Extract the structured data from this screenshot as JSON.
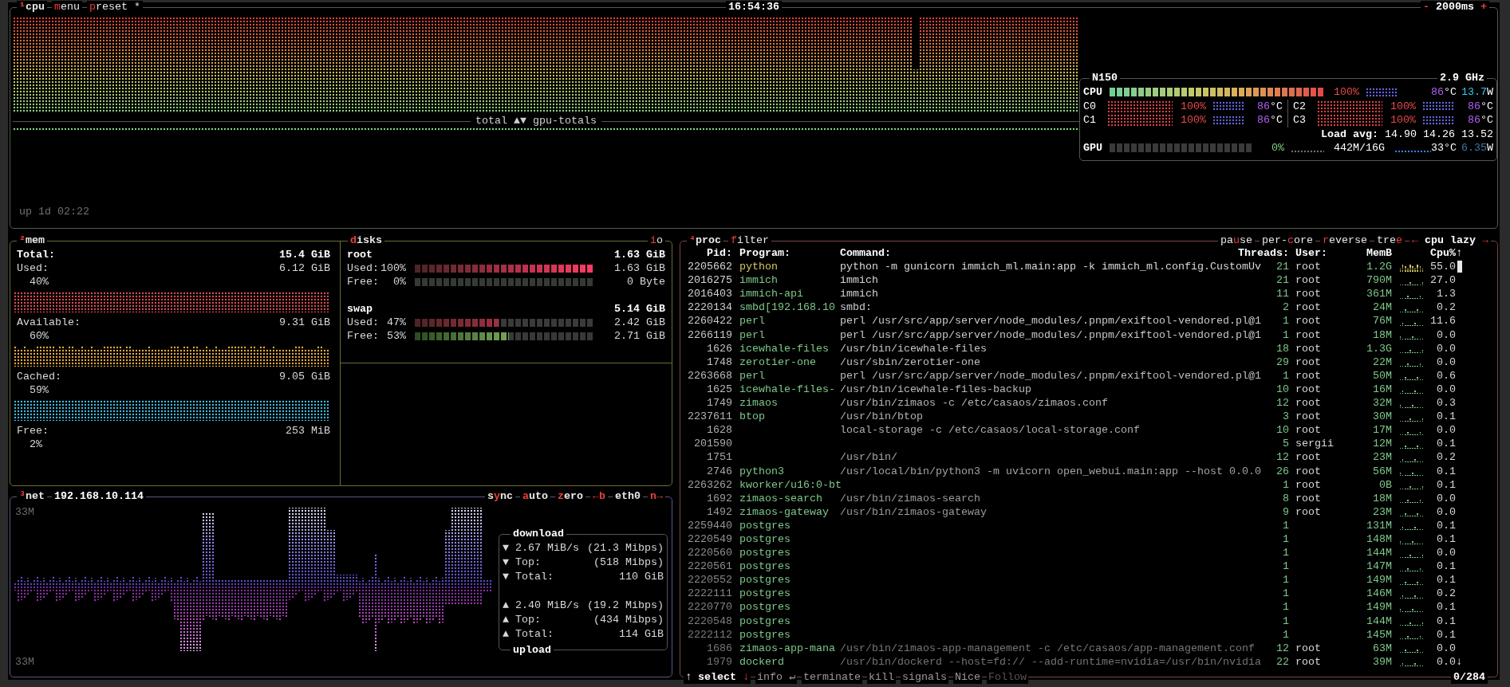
{
  "cpu_box": {
    "title": [
      {
        "key": "¹",
        "after": "cpu"
      },
      {
        "key": "m",
        "after": "enu"
      },
      {
        "key": "p",
        "after": "reset *"
      }
    ],
    "clock": "16:54:36",
    "interval": {
      "minus": "-",
      "value": "2000ms",
      "plus": "+"
    },
    "graph_label": "total ▲▼ gpu-totals",
    "uptime": "up 1d 02:22",
    "info": {
      "model": "N150",
      "frequency": "2.9 GHz",
      "total": {
        "label": "CPU",
        "percent": "100%",
        "temp": "86",
        "temp_unit": "°C",
        "power": "13.7",
        "power_unit": "W"
      },
      "cores": [
        {
          "label": "C0",
          "percent": "100%",
          "temp": "86",
          "temp_unit": "°C"
        },
        {
          "label": "C2",
          "percent": "100%",
          "temp": "86",
          "temp_unit": "°C"
        },
        {
          "label": "C1",
          "percent": "100%",
          "temp": "86",
          "temp_unit": "°C"
        },
        {
          "label": "C3",
          "percent": "100%",
          "temp": "86",
          "temp_unit": "°C"
        }
      ],
      "load_avg": {
        "label": "Load avg:",
        "values": [
          "14.90",
          "14.26",
          "13.52"
        ]
      },
      "gpu": {
        "label": "GPU",
        "percent": "0%",
        "memory": "442M/16G",
        "temp": "33°C",
        "power": "6.35",
        "power_unit": "W"
      }
    }
  },
  "mem": {
    "title": {
      "key": "²",
      "after": "mem"
    },
    "total": {
      "label": "Total:",
      "value": "15.4 GiB"
    },
    "items": [
      {
        "label": "Used:",
        "value": "6.12 GiB",
        "percent": "40%",
        "color": "#e8505a"
      },
      {
        "label": "Available:",
        "value": "9.31 GiB",
        "percent": "60%",
        "color": "#f2b53a"
      },
      {
        "label": "Cached:",
        "value": "9.05 GiB",
        "percent": "59%",
        "color": "#3fc8f2"
      },
      {
        "label": "Free:",
        "value": "253 MiB",
        "percent": "2%"
      }
    ]
  },
  "disks": {
    "title": {
      "key": "d",
      "after": "isks"
    },
    "io": {
      "key": "i",
      "after": "o"
    },
    "devices": [
      {
        "name": "root",
        "total": "1.63 GiB",
        "rows": [
          {
            "kind": "used",
            "label": "Used:",
            "percent": "100%",
            "value": "1.63 GiB"
          },
          {
            "kind": "free",
            "label": "Free:",
            "percent": "0%",
            "value": "0 Byte"
          }
        ]
      },
      {
        "name": "swap",
        "total": "5.14 GiB",
        "rows": [
          {
            "kind": "used",
            "label": "Used:",
            "percent": "47%",
            "level": 0.47,
            "value": "2.42 GiB"
          },
          {
            "kind": "free",
            "label": "Free:",
            "percent": "53%",
            "level": 0.53,
            "value": "2.71 GiB"
          }
        ]
      }
    ]
  },
  "net": {
    "title": {
      "key": "³",
      "after": "net"
    },
    "address": "192.168.10.114",
    "controls": [
      {
        "before": "s",
        "key": "y",
        "after": "nc"
      },
      {
        "key": "a",
        "after": "uto"
      },
      {
        "key": "z",
        "after": "ero"
      },
      {
        "key": "←b"
      },
      {
        "before": "eth0"
      },
      {
        "key": "n→"
      }
    ],
    "scale_top": "33M",
    "scale_bottom": "33M",
    "download": {
      "title": "download",
      "rows": [
        {
          "arrow": "▼",
          "label": "2.67 MiB/s",
          "value": "(21.3 Mibps)"
        },
        {
          "arrow": "▼",
          "label": "Top:",
          "value": "(518 Mibps)"
        },
        {
          "arrow": "▼",
          "label": "Total:",
          "value": "110 GiB"
        }
      ]
    },
    "upload": {
      "title": "upload",
      "rows": [
        {
          "arrow": "▲",
          "label": "2.40 MiB/s",
          "value": "(19.2 Mibps)"
        },
        {
          "arrow": "▲",
          "label": "Top:",
          "value": "(434 Mibps)"
        },
        {
          "arrow": "▲",
          "label": "Total:",
          "value": "114 GiB"
        }
      ]
    }
  },
  "proc": {
    "title": [
      {
        "key": "⁴",
        "after": "proc"
      },
      {
        "key": "f",
        "after": "ilter"
      }
    ],
    "options": [
      {
        "before": "pa",
        "key": "u",
        "after": "se"
      },
      {
        "before": "per-",
        "key": "c",
        "after": "ore"
      },
      {
        "key": "r",
        "after": "everse"
      },
      {
        "before": "tre",
        "key": "e"
      }
    ],
    "sort": {
      "left": "←",
      "label": "cpu lazy",
      "right": "→"
    },
    "columns": [
      "Pid:",
      "Program:",
      "Command:",
      "Threads:",
      "User:",
      "MemB",
      "Cpu%",
      "↑"
    ],
    "rows": [
      {
        "pid": "2205662",
        "program": "python",
        "command": "python -m gunicorn immich_ml.main:app -k immich_ml.config.CustomUv",
        "threads": "21",
        "user": "root",
        "mem": "1.2G",
        "cpu": "55.0",
        "color": "#d8c860"
      },
      {
        "pid": "2016275",
        "program": "immich",
        "command": "immich",
        "threads": "21",
        "user": "root",
        "mem": "790M",
        "cpu": "27.0",
        "color": "#7ec88a"
      },
      {
        "pid": "2016403",
        "program": "immich-api",
        "command": "immich",
        "threads": "11",
        "user": "root",
        "mem": "361M",
        "cpu": "1.3",
        "color": "#7ec88a"
      },
      {
        "pid": "2220134",
        "program": "smbd[192.168.10",
        "command": "smbd:",
        "threads": "2",
        "user": "root",
        "mem": "24M",
        "cpu": "0.2",
        "color": "#7ec88a"
      },
      {
        "pid": "2260422",
        "program": "perl",
        "command": "perl /usr/src/app/server/node_modules/.pnpm/exiftool-vendored.pl@1",
        "threads": "1",
        "user": "root",
        "mem": "76M",
        "cpu": "11.6",
        "color": "#7ec88a"
      },
      {
        "pid": "2266119",
        "program": "perl",
        "command": "perl /usr/src/app/server/node_modules/.pnpm/exiftool-vendored.pl@1",
        "threads": "1",
        "user": "root",
        "mem": "18M",
        "cpu": "0.0",
        "color": "#7ec88a"
      },
      {
        "pid": "1626",
        "program": "icewhale-files",
        "command": "/usr/bin/icewhale-files",
        "threads": "18",
        "user": "root",
        "mem": "1.3G",
        "cpu": "0.0",
        "color": "#7ec88a"
      },
      {
        "pid": "1748",
        "program": "zerotier-one",
        "command": "/usr/sbin/zerotier-one",
        "threads": "29",
        "user": "root",
        "mem": "22M",
        "cpu": "0.0",
        "color": "#7ec88a"
      },
      {
        "pid": "2263668",
        "program": "perl",
        "command": "perl /usr/src/app/server/node_modules/.pnpm/exiftool-vendored.pl@1",
        "threads": "1",
        "user": "root",
        "mem": "50M",
        "cpu": "0.6",
        "color": "#7ec88a"
      },
      {
        "pid": "1625",
        "program": "icewhale-files-",
        "command": "/usr/bin/icewhale-files-backup",
        "threads": "10",
        "user": "root",
        "mem": "16M",
        "cpu": "0.0",
        "color": "#7ec88a"
      },
      {
        "pid": "1749",
        "program": "zimaos",
        "command": "/usr/bin/zimaos -c /etc/casaos/zimaos.conf",
        "threads": "12",
        "user": "root",
        "mem": "32M",
        "cpu": "0.3",
        "color": "#7ec88a"
      },
      {
        "pid": "2237611",
        "program": "btop",
        "command": "/usr/bin/btop",
        "threads": "3",
        "user": "root",
        "mem": "30M",
        "cpu": "0.1",
        "color": "#7ec88a"
      },
      {
        "pid": "1628",
        "command": "local-storage -c /etc/casaos/local-storage.conf",
        "threads": "10",
        "user": "root",
        "mem": "17M",
        "cpu": "0.0",
        "color": "#7ec88a"
      },
      {
        "pid": "201590",
        "threads": "5",
        "user": "sergii",
        "mem": "12M",
        "cpu": "0.1",
        "color": "#7ec88a"
      },
      {
        "pid": "1751",
        "command": "/usr/bin/",
        "threads": "12",
        "user": "root",
        "mem": "23M",
        "cpu": "0.2",
        "color": "#7ec88a"
      },
      {
        "pid": "2746",
        "program": "python3",
        "command": "/usr/local/bin/python3 -m uvicorn open_webui.main:app --host 0.0.0",
        "threads": "26",
        "user": "root",
        "mem": "56M",
        "cpu": "0.1",
        "color": "#7ec88a"
      },
      {
        "pid": "2263262",
        "program": "kworker/u16:0-bt",
        "threads": "1",
        "user": "root",
        "mem": "0B",
        "cpu": "0.1",
        "color": "#7ec88a"
      },
      {
        "pid": "1692",
        "program": "zimaos-search",
        "command": "/usr/bin/zimaos-search",
        "threads": "8",
        "user": "root",
        "mem": "18M",
        "cpu": "0.0",
        "color": "#7ec88a"
      },
      {
        "pid": "1492",
        "program": "zimaos-gateway",
        "command": "/usr/bin/zimaos-gateway",
        "threads": "9",
        "user": "root",
        "mem": "23M",
        "cpu": "0.0",
        "color": "#7ec88a"
      },
      {
        "pid": "2259440",
        "program": "postgres",
        "threads": "1",
        "mem": "131M",
        "cpu": "0.1",
        "color": "#7ec88a"
      },
      {
        "pid": "2220549",
        "program": "postgres",
        "threads": "1",
        "mem": "148M",
        "cpu": "0.1",
        "color": "#7ec88a"
      },
      {
        "pid": "2220560",
        "program": "postgres",
        "threads": "1",
        "mem": "144M",
        "cpu": "0.0",
        "color": "#7ec88a"
      },
      {
        "pid": "2220561",
        "program": "postgres",
        "threads": "1",
        "mem": "147M",
        "cpu": "0.1",
        "color": "#7ec88a"
      },
      {
        "pid": "2220552",
        "program": "postgres",
        "threads": "1",
        "mem": "149M",
        "cpu": "0.1",
        "color": "#7ec88a"
      },
      {
        "pid": "2222111",
        "program": "postgres",
        "threads": "1",
        "mem": "146M",
        "cpu": "0.2",
        "color": "#7ec88a"
      },
      {
        "pid": "2220770",
        "program": "postgres",
        "threads": "1",
        "mem": "149M",
        "cpu": "0.1",
        "color": "#7ec88a"
      },
      {
        "pid": "2220548",
        "program": "postgres",
        "threads": "1",
        "mem": "144M",
        "cpu": "0.1",
        "color": "#7ec88a"
      },
      {
        "pid": "2222112",
        "program": "postgres",
        "threads": "1",
        "mem": "145M",
        "cpu": "0.1",
        "color": "#7ec88a"
      },
      {
        "pid": "1686",
        "program": "zimaos-app-mana",
        "command": "/usr/bin/zimaos-app-management -c /etc/casaos/app-management.conf",
        "threads": "12",
        "user": "root",
        "mem": "63M",
        "cpu": "0.0",
        "color": "#7ec88a"
      },
      {
        "pid": "1979",
        "program": "dockerd",
        "command": "/usr/bin/dockerd --host=fd:// --add-runtime=nvidia=/usr/bin/nvidia",
        "threads": "22",
        "user": "root",
        "mem": "39M",
        "cpu": "0.0",
        "color": "#7ec88a"
      }
    ],
    "scroll_down": "↓",
    "footer": [
      {
        "before": "↑",
        "label": "select",
        "after": "↓",
        "active": true,
        "disabled": false
      },
      {
        "label": "info",
        "after": "↵",
        "active": false,
        "disabled": false
      },
      {
        "label": "terminate",
        "active": false,
        "disabled": false
      },
      {
        "label": "kill",
        "active": false,
        "disabled": false
      },
      {
        "label": "signals",
        "active": false,
        "disabled": false
      },
      {
        "label": "Nice",
        "active": false,
        "disabled": false
      },
      {
        "label": "Follow",
        "active": false,
        "disabled": true
      }
    ],
    "count": "0/284"
  }
}
